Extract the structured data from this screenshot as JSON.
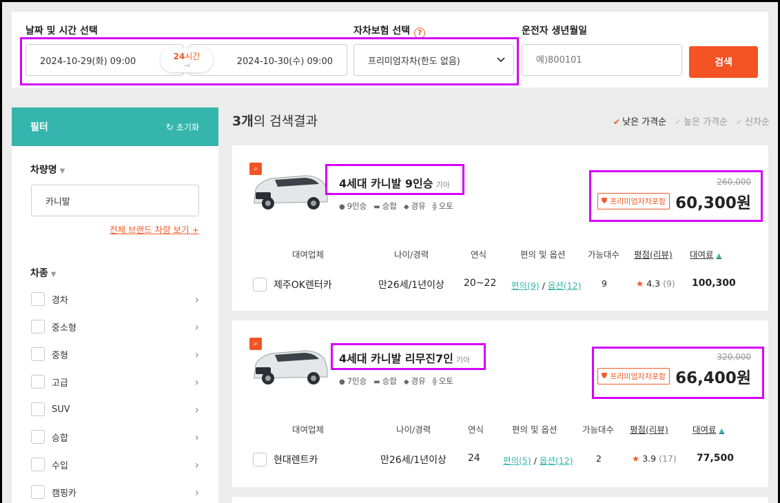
{
  "search": {
    "date_label": "날짜 및 시간 선택",
    "start": "2024-10-29(화) 09:00",
    "end": "2024-10-30(수) 09:00",
    "hours_num": "24",
    "hours_unit": "시간",
    "hours_arrow": "→",
    "insurance_label": "자차보험 선택",
    "insurance_help": "?",
    "insurance_value": "프리미엄자차(한도 없음)",
    "birth_label": "운전자 생년월일",
    "birth_placeholder": "예)800101",
    "search_button": "검색"
  },
  "sidebar": {
    "title": "필터",
    "reset": "초기화",
    "car_name_title": "차량명",
    "car_name_value": "카니발",
    "brand_link": "전체 브랜드 차량 보기 +",
    "type_title": "차종",
    "types": [
      "경차",
      "중소형",
      "중형",
      "고급",
      "SUV",
      "승합",
      "수입",
      "캠핑카"
    ]
  },
  "results": {
    "count": "3개",
    "suffix": "의 검색결과",
    "sorts": [
      "낮은 가격순",
      "높은 가격순",
      "신차순"
    ]
  },
  "cards": [
    {
      "name": "4세대 카니발 9인승",
      "brand": "기아",
      "seats": "9인승",
      "class": "승합",
      "fuel": "경유",
      "gear": "오토",
      "orig_price": "260,000",
      "badge": "프리미엄자차포함",
      "price": "60,300원",
      "headers": [
        "대여업체",
        "나이/경력",
        "연식",
        "편의 및 옵션",
        "가능대수",
        "평점(리뷰)",
        "대여료"
      ],
      "company": "제주OK렌터카",
      "age": "만26세/1년이상",
      "year": "20~22",
      "conv": "편의(9)",
      "sep": " / ",
      "option": "옵션(12)",
      "count": "9",
      "rating": "4.3",
      "reviews": "(9)",
      "fee": "100,300"
    },
    {
      "name": "4세대 카니발 리무진7인",
      "brand": "기아",
      "seats": "7인승",
      "class": "승합",
      "fuel": "경유",
      "gear": "오토",
      "orig_price": "320,000",
      "badge": "프리미엄자차포함",
      "price": "66,400원",
      "headers": [
        "대여업체",
        "나이/경력",
        "연식",
        "편의 및 옵션",
        "가능대수",
        "평점(리뷰)",
        "대여료"
      ],
      "company": "현대렌트카",
      "age": "만26세/1년이상",
      "year": "24",
      "conv": "편의(5)",
      "sep": " / ",
      "option": "옵션(12)",
      "count": "2",
      "rating": "3.9",
      "reviews": "(17)",
      "fee": "77,500"
    }
  ],
  "colors": {
    "accent": "#f45324",
    "teal": "#36b5ad",
    "highlight": "#d500f9"
  }
}
